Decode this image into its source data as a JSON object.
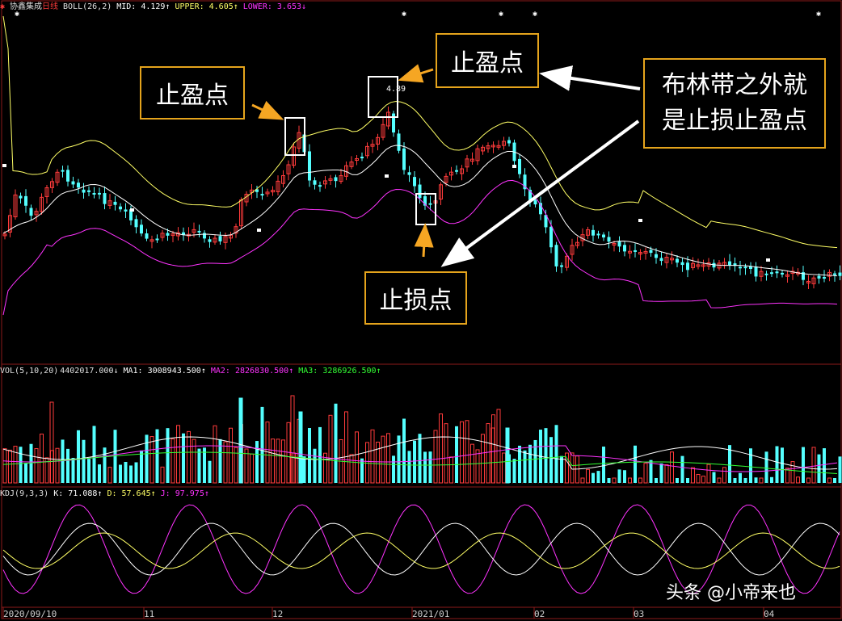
{
  "boll_header": {
    "stock": "协鑫集成",
    "period": "日线",
    "indicator": "BOLL(26,2)",
    "mid": "MID: 4.129↑",
    "upper": "UPPER: 4.605↑",
    "lower": "LOWER: 3.653↓"
  },
  "vol_header": {
    "indicator": "VOL(5,10,20)",
    "vol": "4402017.000↓",
    "ma1": "MA1: 3008943.500↑",
    "ma2": "MA2: 2826830.500↑",
    "ma3": "MA3: 3286926.500↑"
  },
  "kdj_header": {
    "indicator": "KDJ(9,3,3)",
    "k": "K: 71.088↑",
    "d": "D: 57.645↑",
    "j": "J: 97.975↑"
  },
  "callouts": {
    "take_profit_left": "止盈点",
    "take_profit_top": "止盈点",
    "boll_note": "布林带之外就是止损止盈点",
    "stop_loss": "止损点"
  },
  "price_label": "4.89",
  "x_axis": [
    "2020/09/10",
    "11",
    "12",
    "2021/01",
    "02",
    "03",
    "04"
  ],
  "watermark": "头条 @小帝来也",
  "colors": {
    "up": "#ff3b3b",
    "down": "#54ffff",
    "boll_mid": "#ffffff",
    "boll_upper": "#ffff66",
    "boll_lower": "#ff33ff",
    "callout_border": "#e5a41c",
    "ma1": "#ffffff",
    "ma2": "#ff33ff",
    "ma3": "#33ff33"
  }
}
